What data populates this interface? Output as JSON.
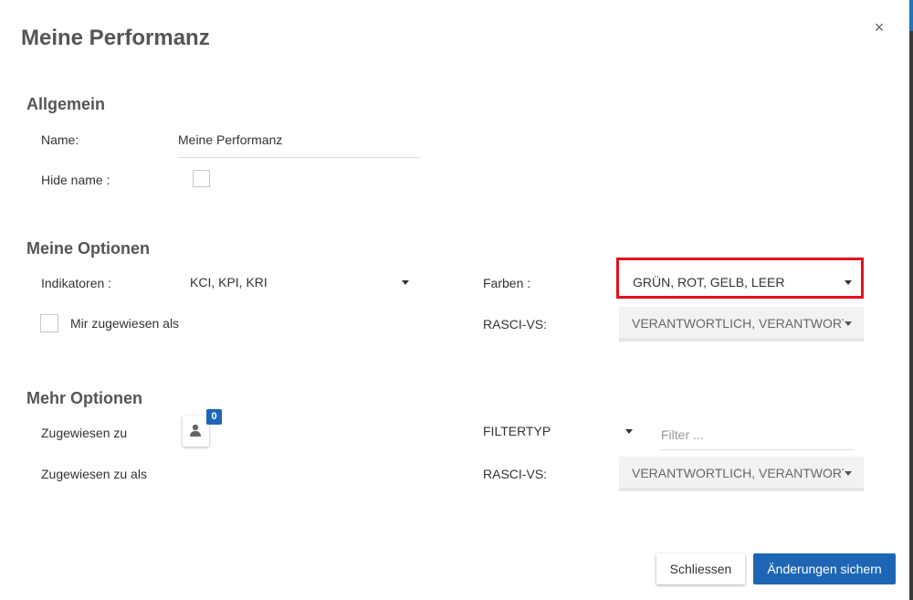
{
  "dialog": {
    "title": "Meine Performanz",
    "close_label": "×"
  },
  "allgemein": {
    "section_title": "Allgemein",
    "name_label": "Name:",
    "name_value": "Meine Performanz",
    "hide_name_label": "Hide name :",
    "hide_name_checked": false
  },
  "meine_optionen": {
    "section_title": "Meine Optionen",
    "indikatoren_label": "Indikatoren :",
    "indikatoren_value": "KCI, KPI, KRI",
    "mir_zugewiesen_label": "Mir zugewiesen als",
    "mir_zugewiesen_checked": false,
    "farben_label": "Farben :",
    "farben_value": "GRÜN, ROT, GELB, LEER",
    "rasci_label": "RASCI-VS:",
    "rasci_value": "VERANTWORTLICH, VERANTWORTLICH"
  },
  "mehr_optionen": {
    "section_title": "Mehr Optionen",
    "zugewiesen_zu_label": "Zugewiesen zu",
    "assignee_count": "0",
    "zugewiesen_zu_als_label": "Zugewiesen zu als",
    "filtertyp_label": "FILTERTYP",
    "filter_placeholder": "Filter ...",
    "rasci_label": "RASCI-VS:",
    "rasci_value": "VERANTWORTLICH, VERANTWORTLICH"
  },
  "footer": {
    "close_button": "Schliessen",
    "save_button": "Änderungen sichern"
  },
  "colors": {
    "primary": "#1e66b5",
    "highlight": "#e3101e"
  },
  "icons": {
    "close": "close-icon",
    "dropdown": "chevron-down-icon",
    "user": "user-icon"
  }
}
